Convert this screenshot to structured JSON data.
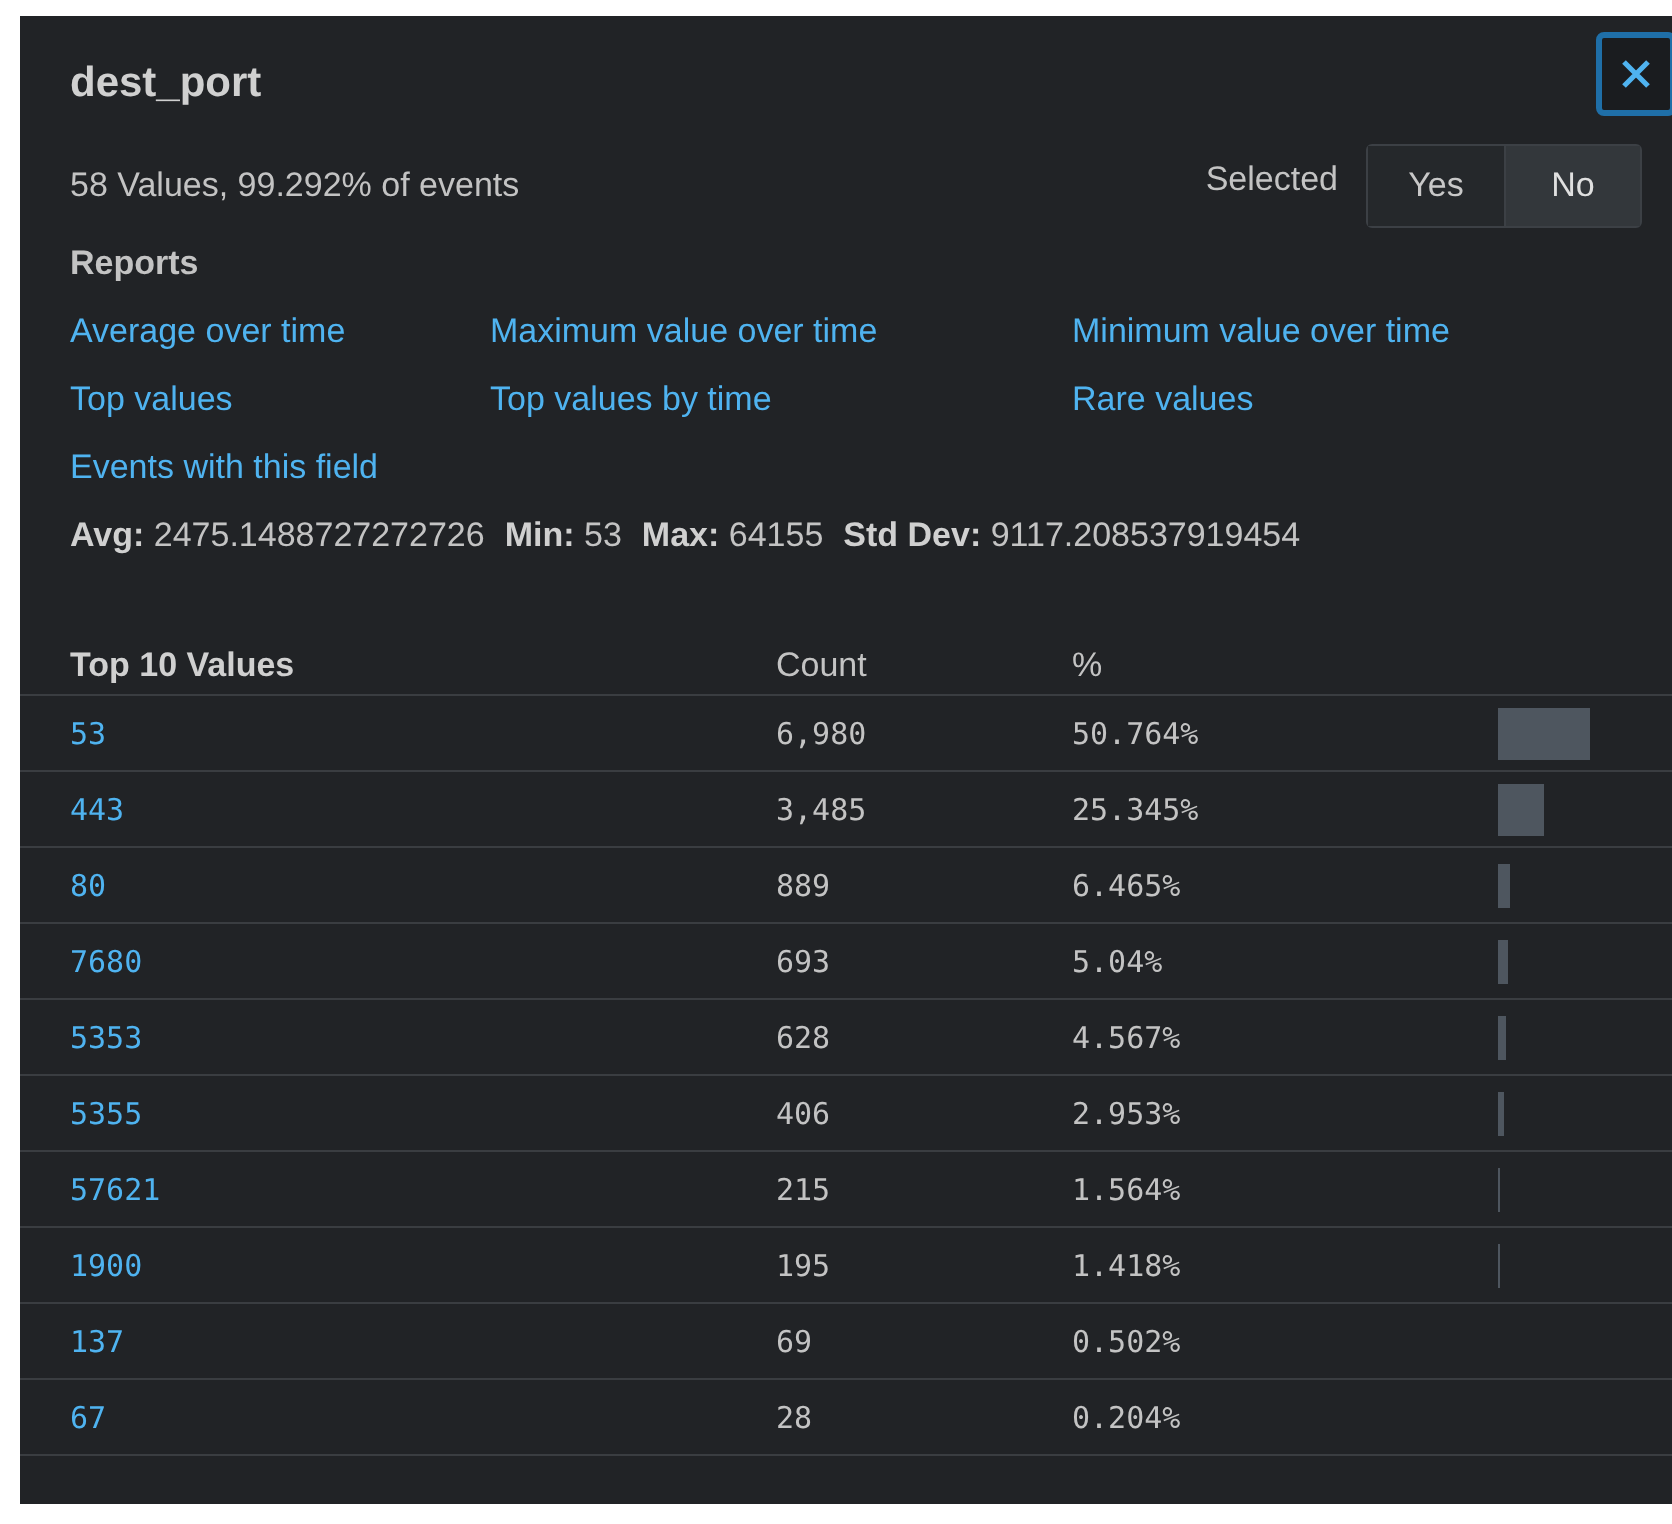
{
  "title": "dest_port",
  "summary": "58 Values, 99.292% of events",
  "selected_toggle": {
    "label": "Selected",
    "options": [
      {
        "label": "Yes",
        "selected": false
      },
      {
        "label": "No",
        "selected": true
      }
    ]
  },
  "reports": {
    "heading": "Reports",
    "links": [
      "Average over time",
      "Maximum value over time",
      "Minimum value over time",
      "Top values",
      "Top values by time",
      "Rare values",
      "Events with this field"
    ]
  },
  "stats": [
    {
      "label": "Avg:",
      "value": "2475.1488727272726"
    },
    {
      "label": "Min:",
      "value": "53"
    },
    {
      "label": "Max:",
      "value": "64155"
    },
    {
      "label": "Std Dev:",
      "value": "9117.208537919454"
    }
  ],
  "table": {
    "columns": [
      "Top 10 Values",
      "Count",
      "%"
    ],
    "rows": [
      {
        "value": "53",
        "count": "6,980",
        "percent": "50.764%"
      },
      {
        "value": "443",
        "count": "3,485",
        "percent": "25.345%"
      },
      {
        "value": "80",
        "count": "889",
        "percent": "6.465%"
      },
      {
        "value": "7680",
        "count": "693",
        "percent": "5.04%"
      },
      {
        "value": "5353",
        "count": "628",
        "percent": "4.567%"
      },
      {
        "value": "5355",
        "count": "406",
        "percent": "2.953%"
      },
      {
        "value": "57621",
        "count": "215",
        "percent": "1.564%"
      },
      {
        "value": "1900",
        "count": "195",
        "percent": "1.418%"
      },
      {
        "value": "137",
        "count": "69",
        "percent": "0.502%"
      },
      {
        "value": "67",
        "count": "28",
        "percent": "0.204%"
      }
    ]
  }
}
